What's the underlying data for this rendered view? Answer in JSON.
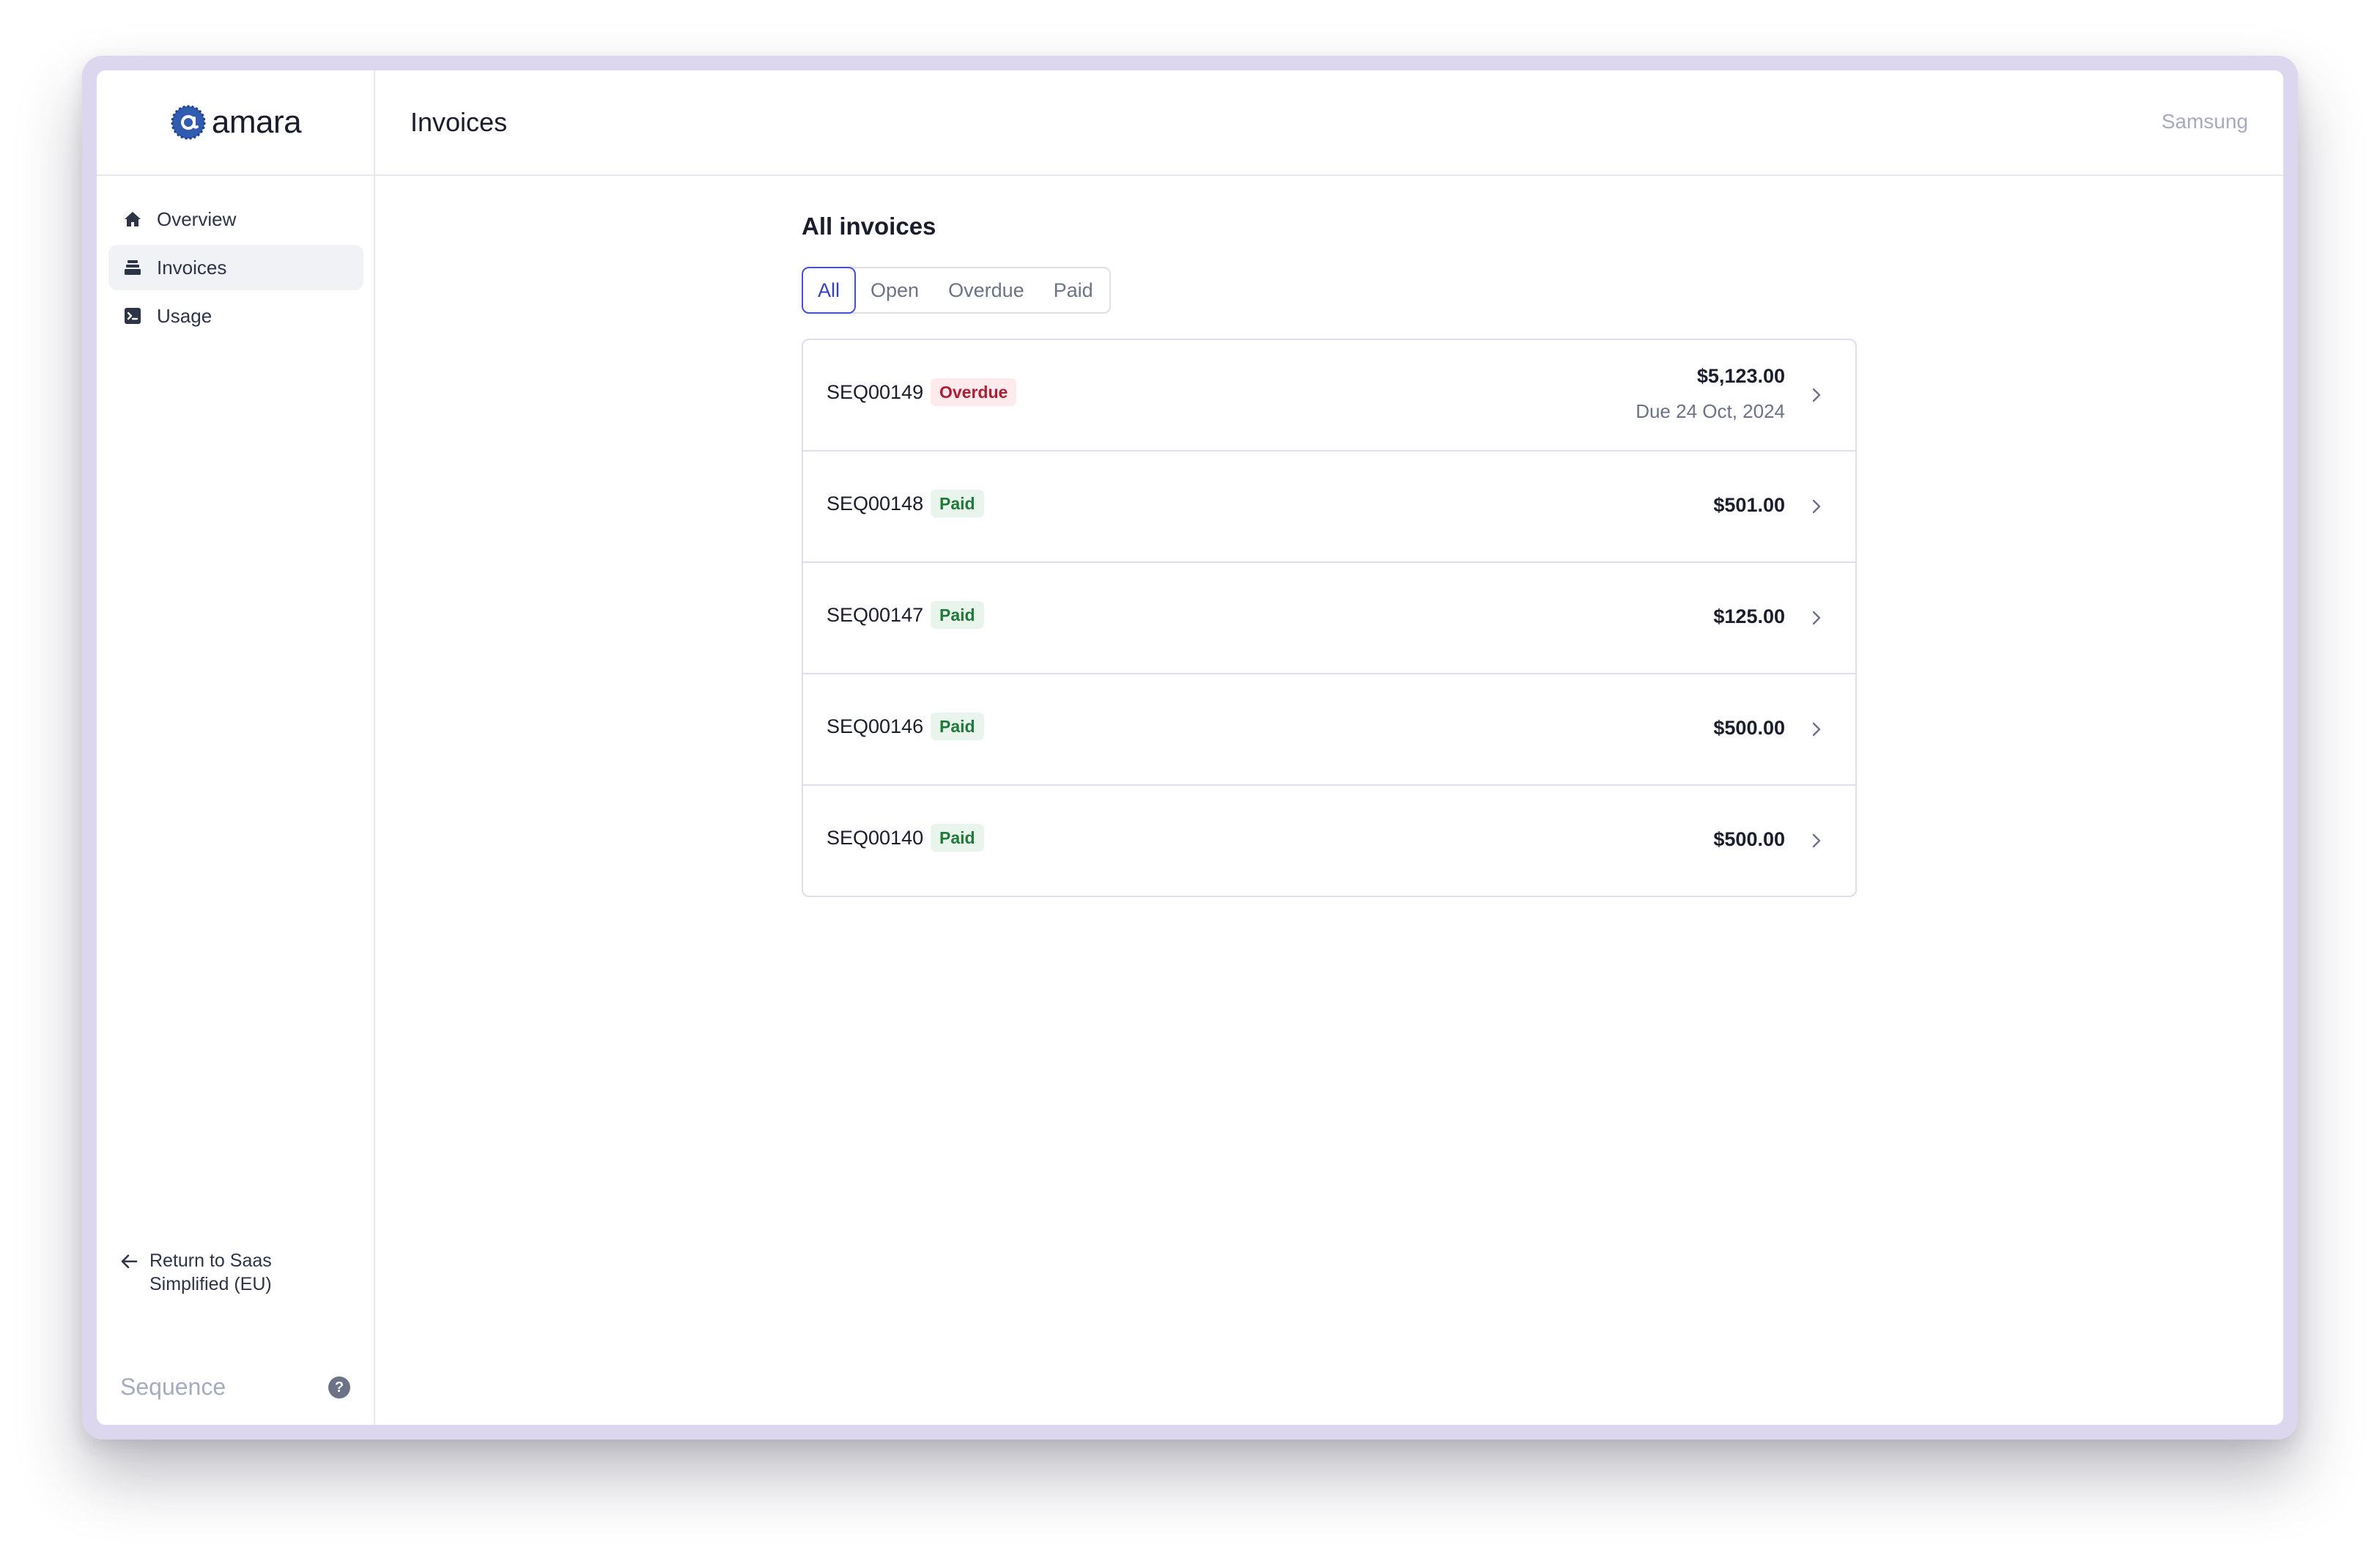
{
  "app": {
    "logo_text": "amara",
    "page_title": "Invoices",
    "org_name": "Samsung",
    "footer_brand": "Sequence",
    "help_glyph": "?"
  },
  "sidebar": {
    "items": [
      {
        "label": "Overview",
        "icon": "home-icon",
        "active": false
      },
      {
        "label": "Invoices",
        "icon": "invoice-stack-icon",
        "active": true
      },
      {
        "label": "Usage",
        "icon": "terminal-icon",
        "active": false
      }
    ],
    "return_line1": "Return to Saas",
    "return_line2": "Simplified (EU)"
  },
  "main": {
    "section_title": "All invoices",
    "tabs": [
      {
        "label": "All",
        "active": true
      },
      {
        "label": "Open",
        "active": false
      },
      {
        "label": "Overdue",
        "active": false
      },
      {
        "label": "Paid",
        "active": false
      }
    ],
    "invoices": [
      {
        "id": "SEQ00149",
        "status": "Overdue",
        "amount": "$5,123.00",
        "due": "Due 24 Oct, 2024"
      },
      {
        "id": "SEQ00148",
        "status": "Paid",
        "amount": "$501.00",
        "due": ""
      },
      {
        "id": "SEQ00147",
        "status": "Paid",
        "amount": "$125.00",
        "due": ""
      },
      {
        "id": "SEQ00146",
        "status": "Paid",
        "amount": "$500.00",
        "due": ""
      },
      {
        "id": "SEQ00140",
        "status": "Paid",
        "amount": "$500.00",
        "due": ""
      }
    ]
  },
  "colors": {
    "accent": "#4451d6",
    "overdue_bg": "#fdeaec",
    "overdue_text": "#b01d33",
    "paid_bg": "#e9f5ec",
    "paid_text": "#1f7a38",
    "logo_blue": "#2f5bb0"
  }
}
